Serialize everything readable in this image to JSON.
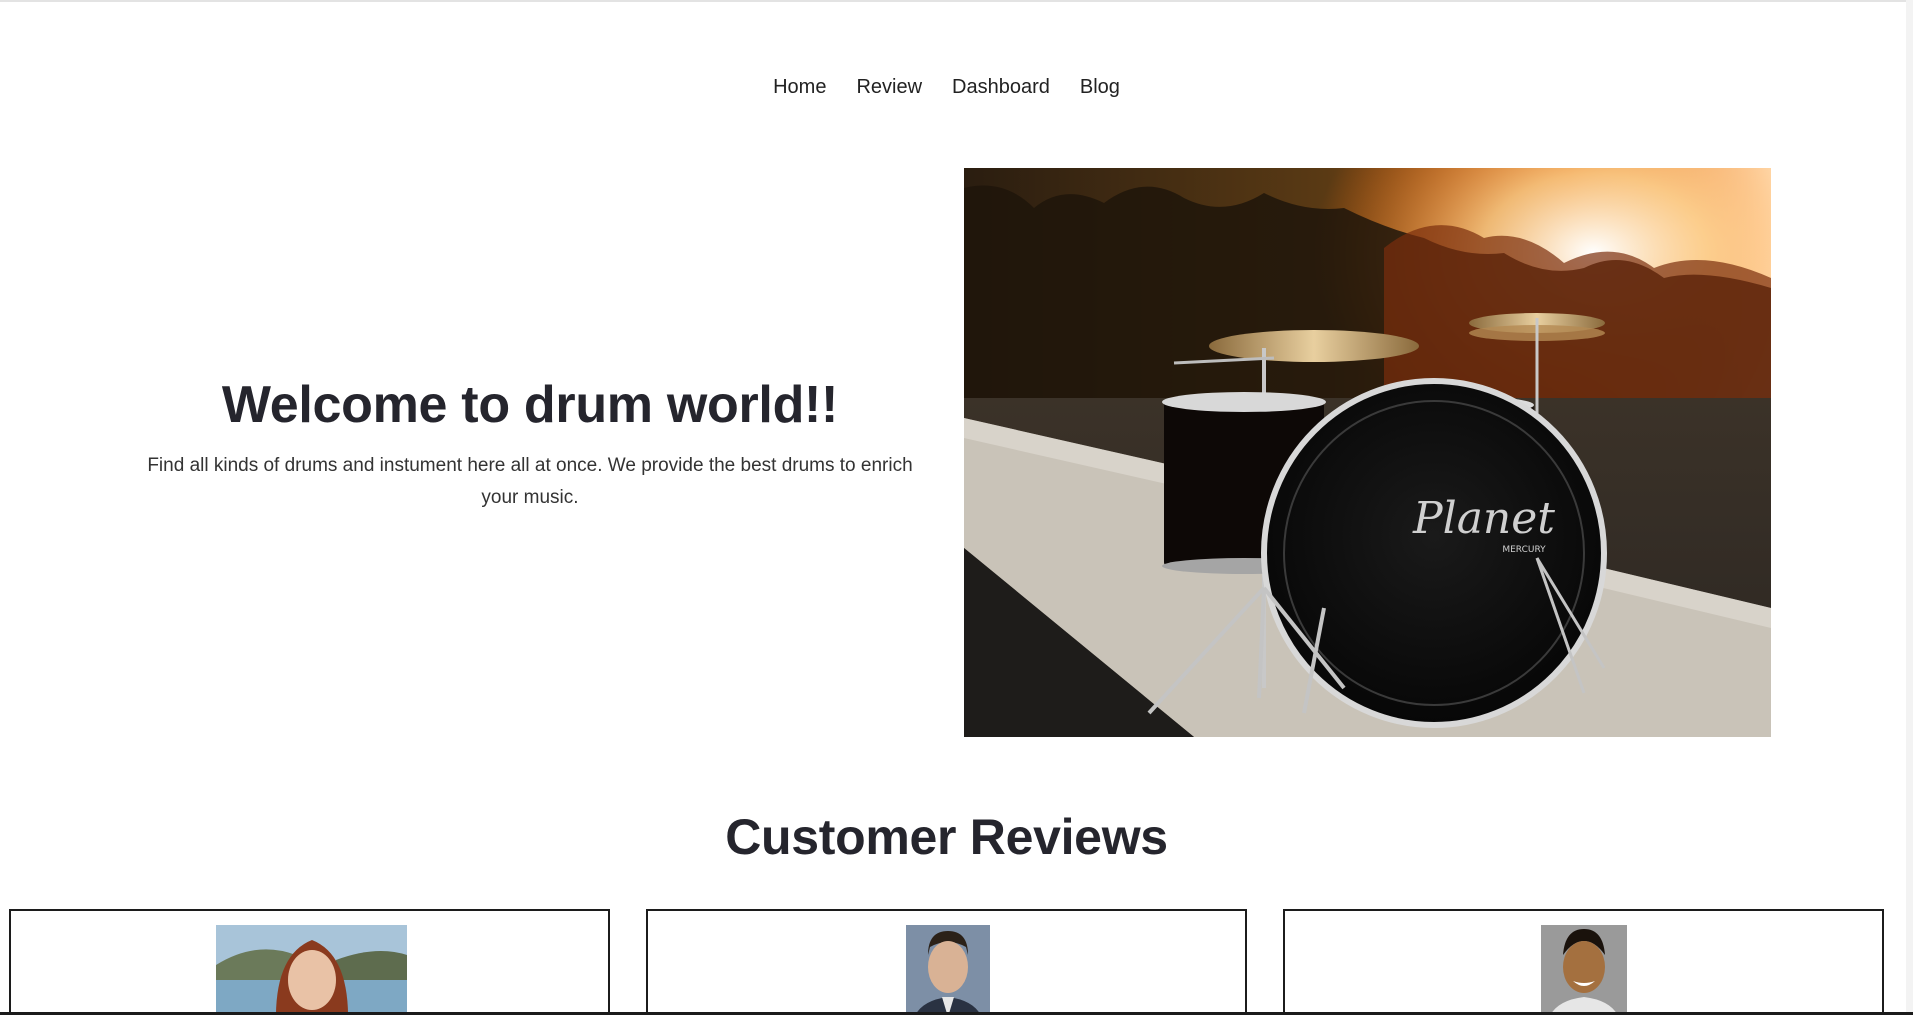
{
  "nav": {
    "items": [
      {
        "label": "Home"
      },
      {
        "label": "Review"
      },
      {
        "label": "Dashboard"
      },
      {
        "label": "Blog"
      }
    ]
  },
  "hero": {
    "title": "Welcome to drum world!!",
    "subtitle": "Find all kinds of drums and instument here all at once. We provide the best drums to enrich your music.",
    "image": {
      "subject": "drum kit at sunset",
      "bass_drum_brand": "Planet",
      "bass_drum_model": "MERCURY"
    }
  },
  "reviews": {
    "title": "Customer Reviews",
    "cards": [
      {
        "avatar": "woman with red hair by a lake"
      },
      {
        "avatar": "man in suit"
      },
      {
        "avatar": "smiling man"
      }
    ]
  },
  "colors": {
    "heading": "#25252d",
    "card_border": "#1c1c1c",
    "background": "#ffffff"
  }
}
